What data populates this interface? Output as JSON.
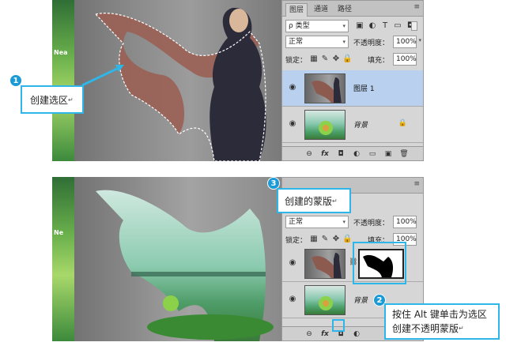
{
  "callouts": {
    "c1": {
      "badge": "1",
      "text": "创建选区"
    },
    "c2": {
      "badge": "2",
      "line1": "按住 Alt 键单击为选区",
      "line2": "创建不透明蒙版"
    },
    "c3": {
      "badge": "3",
      "text": "创建的蒙版"
    }
  },
  "end_mark": "↵",
  "top": {
    "canvas": {
      "strip_text": "Nea"
    },
    "tabs": [
      "图层",
      "通道",
      "路径"
    ],
    "panel_menu": "≡",
    "filter": {
      "value": "ρ 类型"
    },
    "blend": {
      "value": "正常"
    },
    "opacity": {
      "label": "不透明度：",
      "value": "100%"
    },
    "lock": {
      "label": "锁定："
    },
    "fill": {
      "label": "填充：",
      "value": "100%"
    },
    "layers": [
      {
        "name": "图层 1",
        "thumb": "photo",
        "selected": true
      },
      {
        "name": "背景",
        "thumb": "land",
        "selected": false,
        "locked": true
      }
    ]
  },
  "bottom": {
    "canvas": {
      "strip_text": "Ne"
    },
    "blend": {
      "value": "正常"
    },
    "opacity": {
      "label": "不透明度：",
      "value": "100%"
    },
    "lock": {
      "label": "锁定："
    },
    "fill": {
      "label": "填充：",
      "value": "100%"
    },
    "layers": [
      {
        "thumb": "photo",
        "has_mask": true,
        "selected": false
      },
      {
        "name": "背景",
        "thumb": "land",
        "selected": false
      }
    ]
  },
  "icons": {
    "eye": "◉",
    "lock": "🔒",
    "link": "⛓",
    "footer": [
      "⊖",
      "fx",
      "◘",
      "◐",
      "▭",
      "▣",
      "🗑"
    ]
  },
  "colors": {
    "accent": "#2fb6e8",
    "badge": "#1a9ad6",
    "selected_layer": "#b9d1ee"
  }
}
